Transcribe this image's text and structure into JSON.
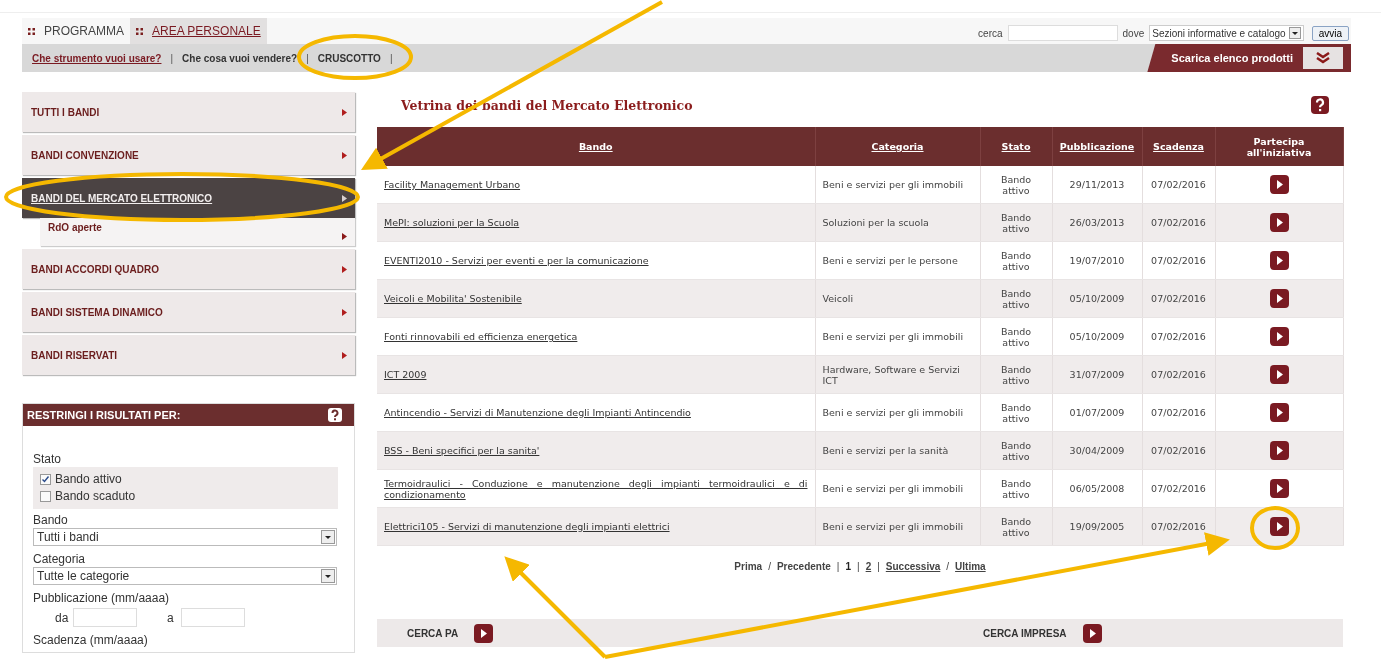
{
  "tabs": [
    {
      "label": "PROGRAMMA",
      "selected": false
    },
    {
      "label": "AREA PERSONALE",
      "selected": true
    }
  ],
  "search": {
    "label": "cerca",
    "where_label": "dove",
    "where_value": "Sezioni informative e catalogo",
    "button": "avvia"
  },
  "subnav": [
    {
      "label": "Che strumento vuoi usare?",
      "kind": "link",
      "separator": "|"
    },
    {
      "label": "Che cosa vuoi vendere?",
      "kind": "plain",
      "separator": "|"
    },
    {
      "label": "CRUSCOTTO",
      "kind": "plain",
      "separator": "|"
    }
  ],
  "download_button": "Scarica elenco prodotti",
  "sidebar": {
    "items": [
      {
        "label": "TUTTI I BANDI",
        "selected": false
      },
      {
        "label": "BANDI CONVENZIONE",
        "selected": false
      },
      {
        "label": "BANDI DEL MERCATO ELETTRONICO",
        "selected": true,
        "children": [
          {
            "label": "RdO aperte"
          }
        ]
      },
      {
        "label": "BANDI ACCORDI QUADRO",
        "selected": false
      },
      {
        "label": "BANDI SISTEMA DINAMICO",
        "selected": false
      },
      {
        "label": "BANDI RISERVATI",
        "selected": false
      }
    ]
  },
  "filters": {
    "title": "RESTRINGI I RISULTATI PER:",
    "status_label": "Stato",
    "checkboxes": [
      {
        "label": "Bando attivo",
        "checked": true
      },
      {
        "label": "Bando scaduto",
        "checked": false
      }
    ],
    "selects": [
      {
        "label": "Bando",
        "value": "Tutti i bandi"
      },
      {
        "label": "Categoria",
        "value": "Tutte le categorie"
      }
    ],
    "publication": {
      "label": "Pubblicazione (mm/aaaa)",
      "from_label": "da",
      "to_label": "a"
    },
    "deadline_label": "Scadenza (mm/aaaa)"
  },
  "main": {
    "title": "Vetrina dei bandi del Mercato Elettronico",
    "table": {
      "columns": [
        "Bando",
        "Categoria",
        "Stato",
        "Pubblicazione",
        "Scadenza",
        "Partecipa all'iniziativa"
      ],
      "rows": [
        [
          "Facility Management Urbano",
          "Beni e servizi per gli immobili",
          "Bando attivo",
          "29/11/2013",
          "07/02/2016"
        ],
        [
          "MePI: soluzioni per la Scuola",
          "Soluzioni per la scuola",
          "Bando attivo",
          "26/03/2013",
          "07/02/2016"
        ],
        [
          "EVENTI2010 - Servizi per eventi e per la comunicazione",
          "Beni e servizi per le persone",
          "Bando attivo",
          "19/07/2010",
          "07/02/2016"
        ],
        [
          "Veicoli e Mobilita' Sostenibile",
          "Veicoli",
          "Bando attivo",
          "05/10/2009",
          "07/02/2016"
        ],
        [
          "Fonti rinnovabili ed efficienza energetica",
          "Beni e servizi per gli immobili",
          "Bando attivo",
          "05/10/2009",
          "07/02/2016"
        ],
        [
          "ICT 2009",
          "Hardware, Software e Servizi ICT",
          "Bando attivo",
          "31/07/2009",
          "07/02/2016"
        ],
        [
          "Antincendio - Servizi di Manutenzione degli Impianti Antincendio",
          "Beni e servizi per gli immobili",
          "Bando attivo",
          "01/07/2009",
          "07/02/2016"
        ],
        [
          "BSS - Beni specifici per la sanita'",
          "Beni e servizi per la sanità",
          "Bando attivo",
          "30/04/2009",
          "07/02/2016"
        ],
        [
          "Termoidraulici - Conduzione e manutenzione degli impianti termoidraulici e di condizionamento",
          "Beni e servizi per gli immobili",
          "Bando attivo",
          "06/05/2008",
          "07/02/2016"
        ],
        [
          "Elettrici105 - Servizi di manutenzione degli impianti elettrici",
          "Beni e servizi per gli immobili",
          "Bando attivo",
          "19/09/2005",
          "07/02/2016"
        ]
      ]
    },
    "pagination": [
      {
        "label": "Prima",
        "kind": "text"
      },
      {
        "label": "/",
        "kind": "sep"
      },
      {
        "label": "Precedente",
        "kind": "text"
      },
      {
        "label": "|",
        "kind": "sep"
      },
      {
        "label": "1",
        "kind": "current"
      },
      {
        "label": "|",
        "kind": "sep"
      },
      {
        "label": "2",
        "kind": "link"
      },
      {
        "label": "|",
        "kind": "sep"
      },
      {
        "label": "Successiva",
        "kind": "link"
      },
      {
        "label": "/",
        "kind": "sep"
      },
      {
        "label": "Ultima",
        "kind": "link"
      }
    ],
    "bottom_links": [
      "CERCA PA",
      "CERCA IMPRESA"
    ]
  }
}
